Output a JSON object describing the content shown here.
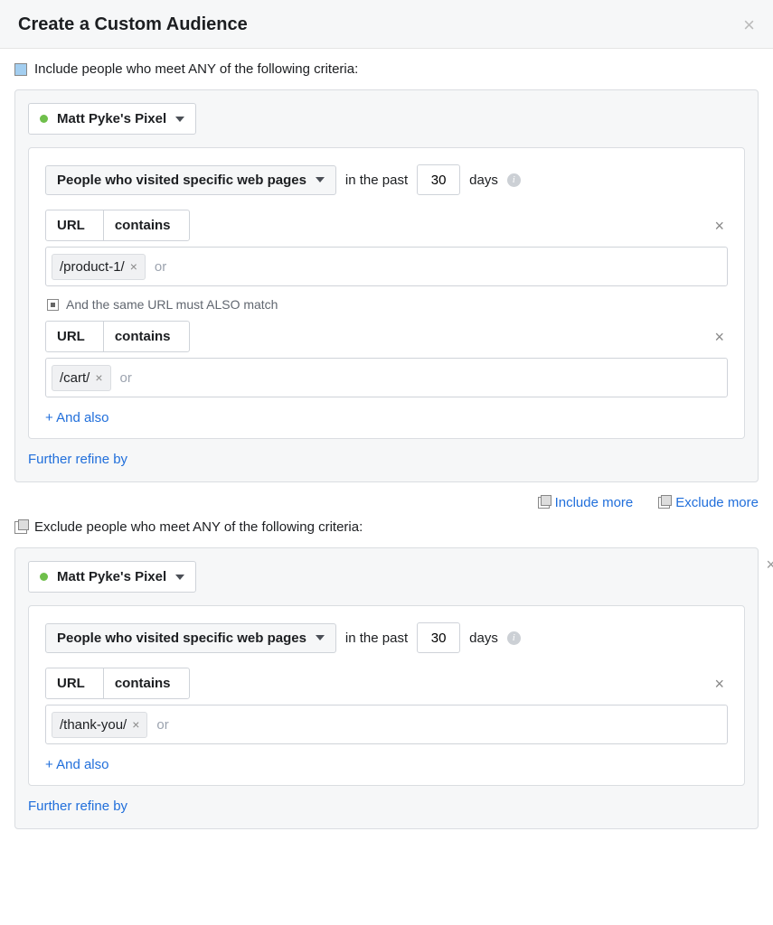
{
  "header": {
    "title": "Create a Custom Audience"
  },
  "include": {
    "label": "Include people who meet ANY of the following criteria:",
    "pixel": "Matt Pyke's Pixel",
    "condition_dd": "People who visited specific web pages",
    "past_prefix": "in the past",
    "days": "30",
    "days_label": "days",
    "url_label": "URL",
    "contains_label": "contains",
    "rule1_tag": "/product-1/",
    "or_hint": "or",
    "also_match": "And the same URL must ALSO match",
    "rule2_tag": "/cart/",
    "and_also": "+ And also",
    "refine": "Further refine by"
  },
  "actions": {
    "include_more": "Include more",
    "exclude_more": "Exclude more"
  },
  "exclude": {
    "label": "Exclude people who meet ANY of the following criteria:",
    "pixel": "Matt Pyke's Pixel",
    "condition_dd": "People who visited specific web pages",
    "past_prefix": "in the past",
    "days": "30",
    "days_label": "days",
    "url_label": "URL",
    "contains_label": "contains",
    "rule1_tag": "/thank-you/",
    "or_hint": "or",
    "and_also": "+ And also",
    "refine": "Further refine by"
  }
}
